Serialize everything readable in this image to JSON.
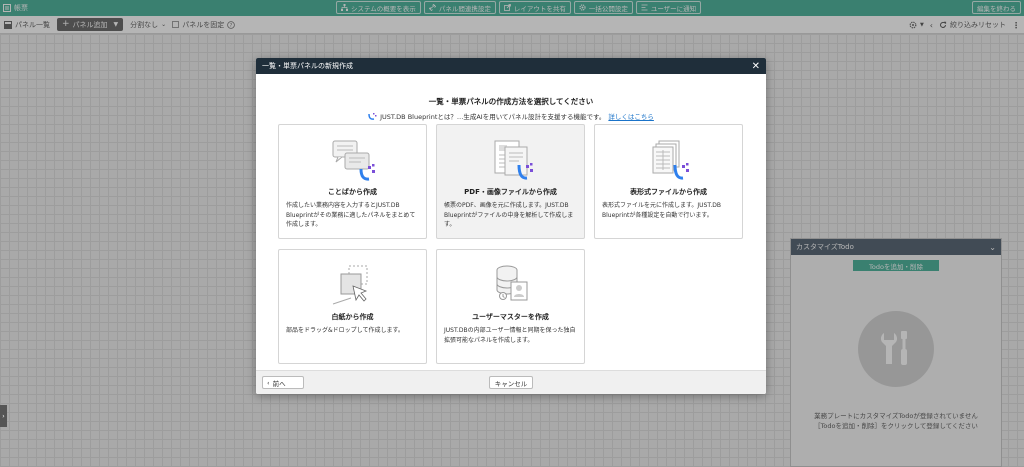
{
  "app": {
    "title": "帳票"
  },
  "header": {
    "buttons": [
      {
        "label": "システムの概要を表示",
        "icon": "sitemap-icon"
      },
      {
        "label": "パネル間連携設定",
        "icon": "link-icon"
      },
      {
        "label": "レイアウトを共有",
        "icon": "share-icon"
      },
      {
        "label": "一括公開設定",
        "icon": "gear-icon"
      },
      {
        "label": "ユーザーに通知",
        "icon": "notify-icon"
      }
    ],
    "finish_label": "編集を終わる"
  },
  "toolbar": {
    "panel_list": "パネル一覧",
    "add_panel": "パネル追加",
    "split": "分割なし",
    "fix_panel": "パネルを固定",
    "reset": "絞り込みリセット"
  },
  "right_panel": {
    "title": "カスタマイズTodo",
    "add_button": "Todoを追加・削除",
    "empty_line1": "業務プレートにカスタマイズTodoが登録されていません",
    "empty_line2": "［Todoを追加・削除］をクリックして登録してください"
  },
  "modal": {
    "header": "一覧・単票パネルの新規作成",
    "title": "一覧・単票パネルの作成方法を選択してください",
    "subtitle": "JUST.DB Blueprintとは？…生成AIを用いてパネル設計を支援する機能です。",
    "link": "詳しくはこちら",
    "cards": [
      {
        "title": "ことばから作成",
        "desc": "作成したい業務内容を入力するとJUST.DB Blueprintがその業務に適したパネルをまとめて作成します。"
      },
      {
        "title": "PDF・画像ファイルから作成",
        "desc": "帳票のPDF、画像を元に作成します。JUST.DB Blueprintがファイルの中身を解析して作成します。"
      },
      {
        "title": "表形式ファイルから作成",
        "desc": "表形式ファイルを元に作成します。JUST.DB Blueprintが各種設定を自動で行います。"
      },
      {
        "title": "白紙から作成",
        "desc": "部品をドラッグ&ドロップして作成します。"
      },
      {
        "title": "ユーザーマスターを作成",
        "desc": "JUST.DBの内部ユーザー情報と同期を保った独自拡張可能なパネルを作成します。"
      }
    ],
    "prev_button": "前へ",
    "cancel_button": "キャンセル"
  },
  "colors": {
    "accent": "#1f9e82",
    "header_dark": "#1f2e3a",
    "ai_blue": "#2f80ed",
    "ai_purple": "#7b4fd8"
  }
}
